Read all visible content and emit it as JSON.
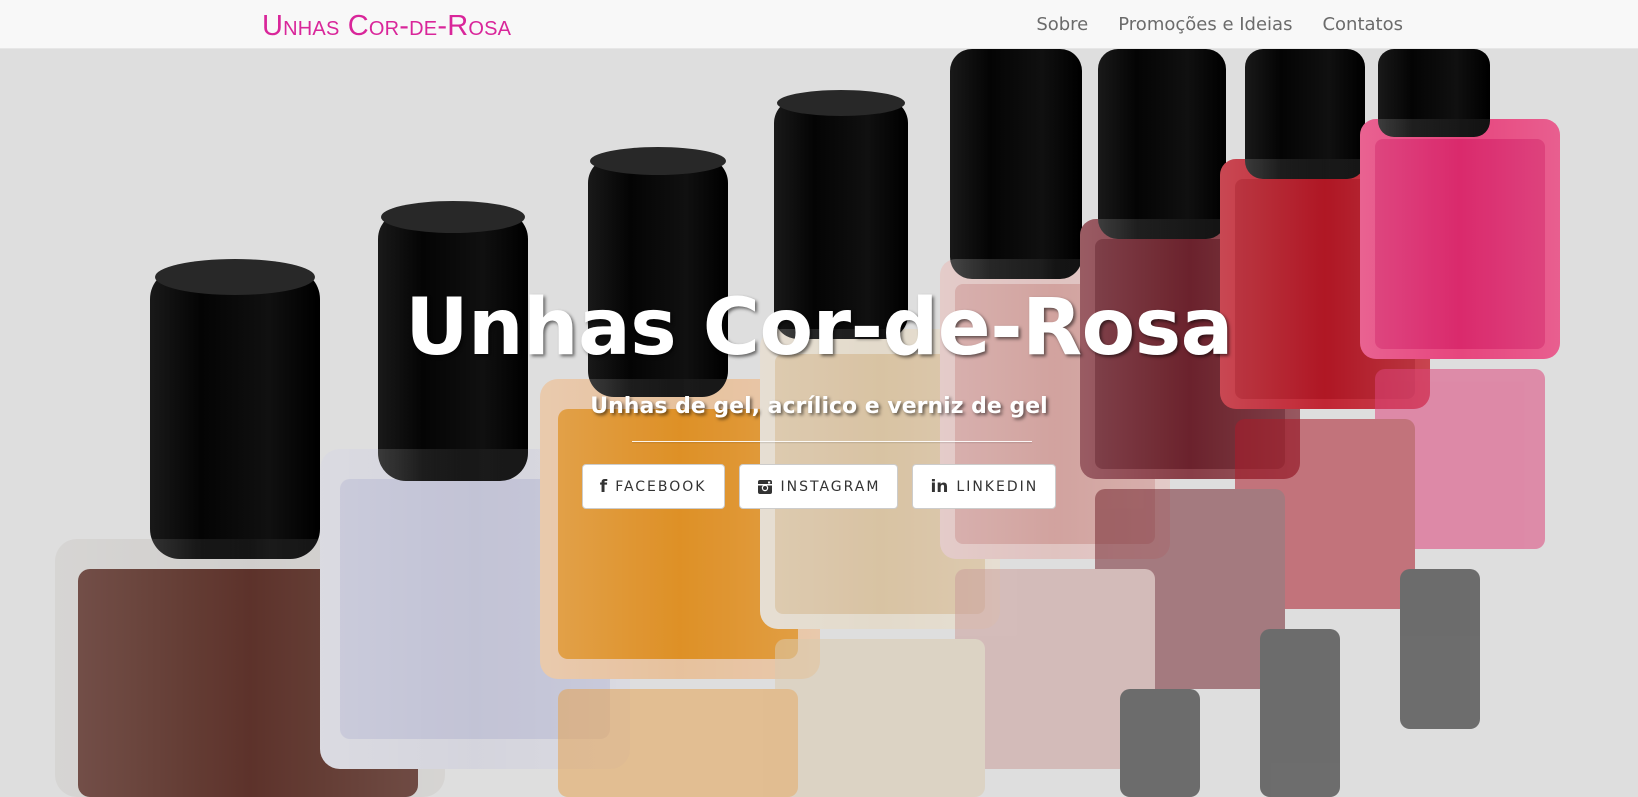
{
  "navbar": {
    "brand": "Unhas Cor-de-Rosa",
    "links": [
      "Sobre",
      "Promoções e Ideias",
      "Contatos"
    ]
  },
  "hero": {
    "title": "Unhas Cor-de-Rosa",
    "subtitle": "Unhas de gel, acrílico e verniz de gel",
    "background_image": "nail-polish-bottles-photo",
    "social": [
      {
        "label": "FACEBOOK",
        "icon": "facebook-icon"
      },
      {
        "label": "INSTAGRAM",
        "icon": "instagram-icon"
      },
      {
        "label": "LINKEDIN",
        "icon": "linkedin-icon"
      }
    ]
  },
  "colors": {
    "brand": "#d9269a",
    "navbar_bg": "#f8f8f8",
    "nav_text": "#6b6b6b",
    "hero_text": "#ffffff"
  }
}
